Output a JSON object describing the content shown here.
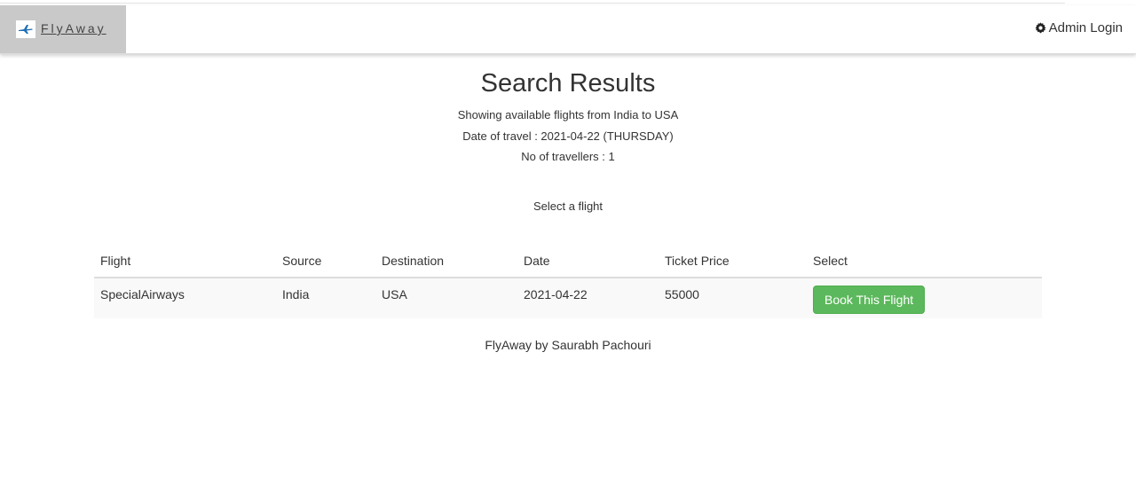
{
  "navbar": {
    "brand_name": "FlyAway",
    "admin_login": "Admin Login"
  },
  "page": {
    "title": "Search Results",
    "route_text": "Showing available flights from India to USA",
    "date_text": "Date of travel : 2021-04-22 (THURSDAY)",
    "travellers_text": "No of travellers : 1",
    "select_prompt": "Select a flight"
  },
  "table": {
    "headers": [
      "Flight",
      "Source",
      "Destination",
      "Date",
      "Ticket Price",
      "Select"
    ],
    "rows": [
      {
        "flight": "SpecialAirways",
        "source": "India",
        "destination": "USA",
        "date": "2021-04-22",
        "price": "55000",
        "button_label": "Book This Flight"
      }
    ]
  },
  "footer": {
    "text": "FlyAway by Saurabh Pachouri"
  },
  "icons": {
    "brand_logo": "airplane-icon",
    "admin": "gear-icon"
  },
  "colors": {
    "brand_bg": "#c9c9c9",
    "button_green": "#5cb85c"
  }
}
